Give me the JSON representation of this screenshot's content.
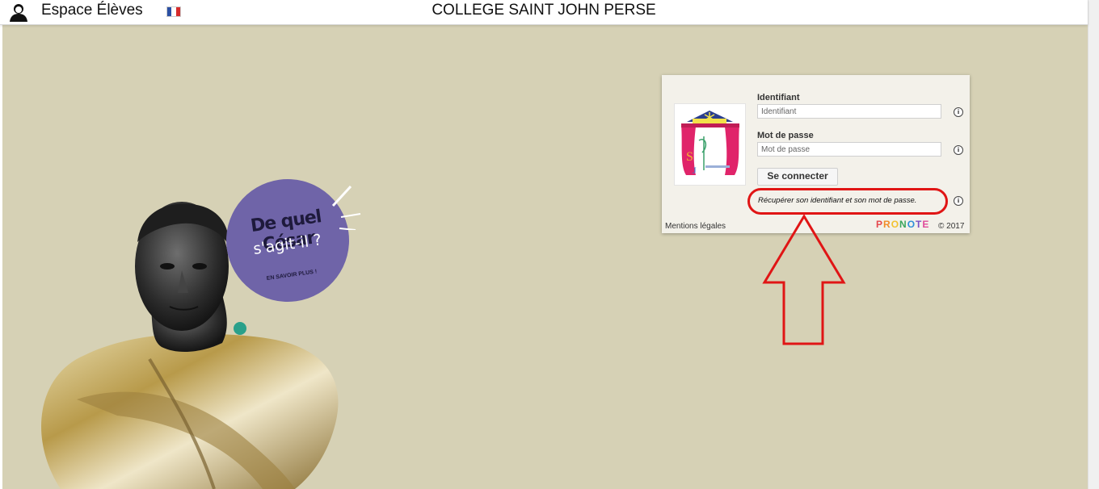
{
  "header": {
    "space_title": "Espace Élèves",
    "school_name": "COLLEGE SAINT JOHN PERSE",
    "language_flag": "flag-fr"
  },
  "promo": {
    "line1": "De quel César",
    "line2": "s'agit-il ?",
    "cta": "EN SAVOIR PLUS !",
    "color": "#6f64a8"
  },
  "login": {
    "identifier_label": "Identifiant",
    "identifier_placeholder": "Identifiant",
    "password_label": "Mot de passe",
    "password_placeholder": "Mot de passe",
    "connect_button": "Se connecter",
    "recover_link": "Récupérer son identifiant et son mot de passe.",
    "legal_link": "Mentions légales",
    "brand": "PRONOTE",
    "copyright": "© 2017"
  },
  "annotation": {
    "highlight_color": "#e01515"
  },
  "colors": {
    "background": "#d6d1b5",
    "panel": "#f3f1ea"
  }
}
